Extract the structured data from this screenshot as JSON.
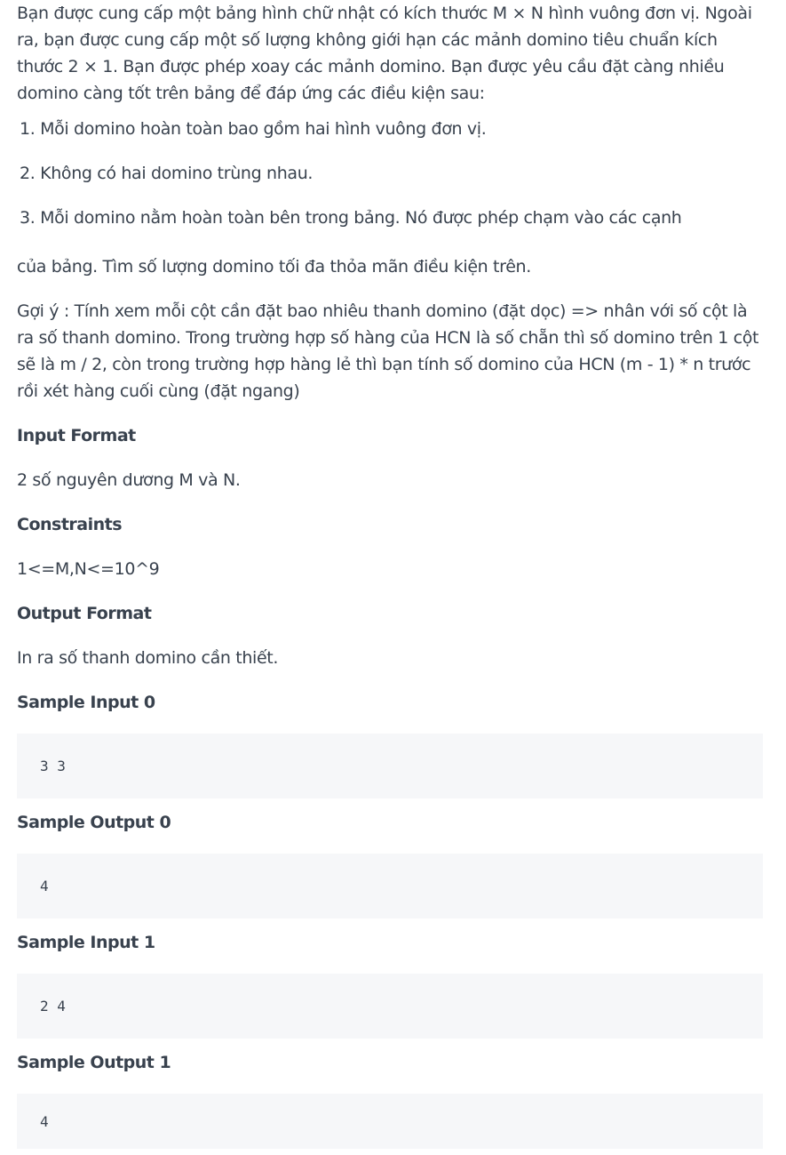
{
  "problem": {
    "intro": "Bạn được cung cấp một bảng hình chữ nhật có kích thước M × N hình vuông đơn vị. Ngoài ra, bạn được cung cấp một số lượng không giới hạn các mảnh domino tiêu chuẩn kích thước 2 × 1. Bạn được phép xoay các mảnh domino. Bạn được yêu cầu đặt càng nhiều domino càng tốt trên bảng để đáp ứng các điều kiện sau:",
    "conditions": [
      "1. Mỗi domino hoàn toàn bao gồm hai hình vuông đơn vị.",
      "2. Không có hai domino trùng nhau.",
      "3. Mỗi domino nằm hoàn toàn bên trong bảng. Nó được phép chạm vào các cạnh"
    ],
    "continuation": "của bảng. Tìm số lượng domino tối đa thỏa mãn điều kiện trên.",
    "hint": "Gợi ý : Tính xem mỗi cột cần đặt bao nhiêu thanh domino (đặt dọc) => nhân với số cột là ra số thanh domino. Trong trường hợp số hàng của HCN là số chẵn thì số domino trên 1 cột sẽ là m / 2, còn trong trường hợp hàng lẻ thì bạn tính số domino của HCN (m - 1) * n trước rồi xét hàng cuối cùng (đặt ngang)"
  },
  "input_format": {
    "heading": "Input Format",
    "text": "2 số nguyên dương M và N."
  },
  "constraints": {
    "heading": "Constraints",
    "text": "1<=M,N<=10^9"
  },
  "output_format": {
    "heading": "Output Format",
    "text": "In ra số thanh domino cần thiết."
  },
  "samples": [
    {
      "heading": "Sample Input 0",
      "value": "3 3"
    },
    {
      "heading": "Sample Output 0",
      "value": "4"
    },
    {
      "heading": "Sample Input 1",
      "value": "2 4"
    },
    {
      "heading": "Sample Output 1",
      "value": "4"
    }
  ]
}
